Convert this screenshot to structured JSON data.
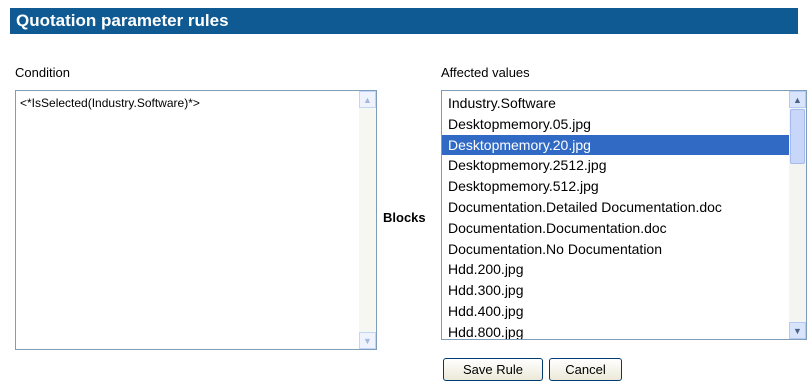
{
  "header": {
    "title": "Quotation parameter rules"
  },
  "condition": {
    "label": "Condition",
    "text": "<*IsSelected(Industry.Software)*>"
  },
  "blocks_label": "Blocks",
  "affected": {
    "label": "Affected values",
    "items": [
      "Industry.Software",
      "Desktopmemory.05.jpg",
      "Desktopmemory.20.jpg",
      "Desktopmemory.2512.jpg",
      "Desktopmemory.512.jpg",
      "Documentation.Detailed Documentation.doc",
      "Documentation.Documentation.doc",
      "Documentation.No Documentation",
      "Hdd.200.jpg",
      "Hdd.300.jpg",
      "Hdd.400.jpg",
      "Hdd.800.jpg"
    ],
    "selected": "Desktopmemory.20.jpg"
  },
  "buttons": {
    "save": "Save Rule",
    "cancel": "Cancel"
  },
  "colors": {
    "header_bg": "#0f5a93",
    "selection_bg": "#316ac5"
  },
  "icons": {
    "scroll_up": "▲",
    "scroll_down": "▼"
  }
}
